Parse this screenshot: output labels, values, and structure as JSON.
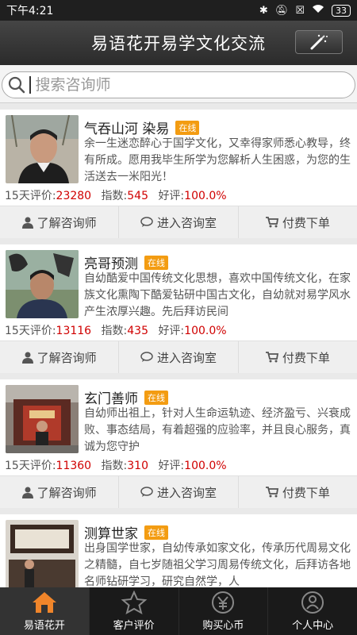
{
  "status": {
    "time": "下午4:21",
    "battery": "33"
  },
  "header": {
    "title": "易语花开易学文化交流"
  },
  "search": {
    "placeholder": "搜索咨询师",
    "value": ""
  },
  "consultants": [
    {
      "name": "气吞山河 染易",
      "badge": "在线",
      "desc": "余一生迷恋醉心于国学文化，又幸得家师悉心教导，终有所成。愿用我毕生所学为您解析人生困惑，为您的生活送去一米阳光！",
      "eval_label": "15天评价:",
      "eval": "23280",
      "index_label": "指数:",
      "index": "545",
      "rating_label": "好评:",
      "rating": "100.0%",
      "actions": [
        "了解咨询师",
        "进入咨询室",
        "付费下单"
      ]
    },
    {
      "name": "亮哥预测",
      "badge": "在线",
      "desc": "自幼酷爱中国传统文化思想，喜欢中国传统文化，在家族文化熏陶下酷爱钻研中国古文化，自幼就对易学风水产生浓厚兴趣。先后拜访民间",
      "eval_label": "15天评价:",
      "eval": "13116",
      "index_label": "指数:",
      "index": "435",
      "rating_label": "好评:",
      "rating": "100.0%",
      "actions": [
        "了解咨询师",
        "进入咨询室",
        "付费下单"
      ]
    },
    {
      "name": "玄门善师",
      "badge": "在线",
      "desc": "自幼师出祖上，针对人生命运轨迹、经济盈亏、兴衰成败、事态结局，有着超强的应验率，并且良心服务，真诚为您守护",
      "eval_label": "15天评价:",
      "eval": "11360",
      "index_label": "指数:",
      "index": "310",
      "rating_label": "好评:",
      "rating": "100.0%",
      "actions": [
        "了解咨询师",
        "进入咨询室",
        "付费下单"
      ]
    },
    {
      "name": "测算世家",
      "badge": "在线",
      "desc": "出身国学世家，自幼传承如家文化，传承历代周易文化之精髓，自七岁随祖父学习周易传统文化，后拜访各地名师钻研学习，研究自然学，人",
      "eval_label": "",
      "eval": "",
      "index_label": "",
      "index": "",
      "rating_label": "",
      "rating": "",
      "actions": []
    }
  ],
  "tabs": [
    "易语花开",
    "客户评价",
    "购买心币",
    "个人中心"
  ],
  "colors": {
    "accent": "#f39c12",
    "numbers": "#d00000",
    "tab_active": "#f0852a"
  }
}
